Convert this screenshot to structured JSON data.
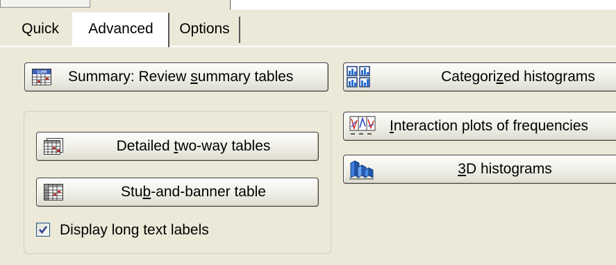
{
  "tabs": {
    "quick": "Quick",
    "advanced": "Advanced",
    "options": "Options",
    "active": "Advanced"
  },
  "buttons": {
    "summary": {
      "pre": "Summary:  Review ",
      "u": "s",
      "post": "ummary tables"
    },
    "categorized": {
      "pre": "Categori",
      "u": "z",
      "post": "ed histograms"
    },
    "interaction": {
      "pre": "",
      "u": "I",
      "post": "nteraction plots of frequencies"
    },
    "hist3d": {
      "pre": "",
      "u": "3",
      "post": "D histograms"
    },
    "detailed": {
      "pre": "Detailed ",
      "u": "t",
      "post": "wo-way tables"
    },
    "stub": {
      "pre": "Stu",
      "u": "b",
      "post": "-and-banner table"
    }
  },
  "checkbox": {
    "label": "Display long text labels",
    "checked": true
  },
  "colors": {
    "background": "#ece9d8",
    "checkmark": "#2a3f8f",
    "border_dark": "#404040"
  },
  "icons": {
    "summary": "summary-table-icon",
    "categorized": "categorized-histogram-icon",
    "interaction": "interaction-plot-icon",
    "hist3d": "3d-histogram-icon",
    "detailed": "two-way-table-icon",
    "stub": "stub-banner-table-icon"
  }
}
